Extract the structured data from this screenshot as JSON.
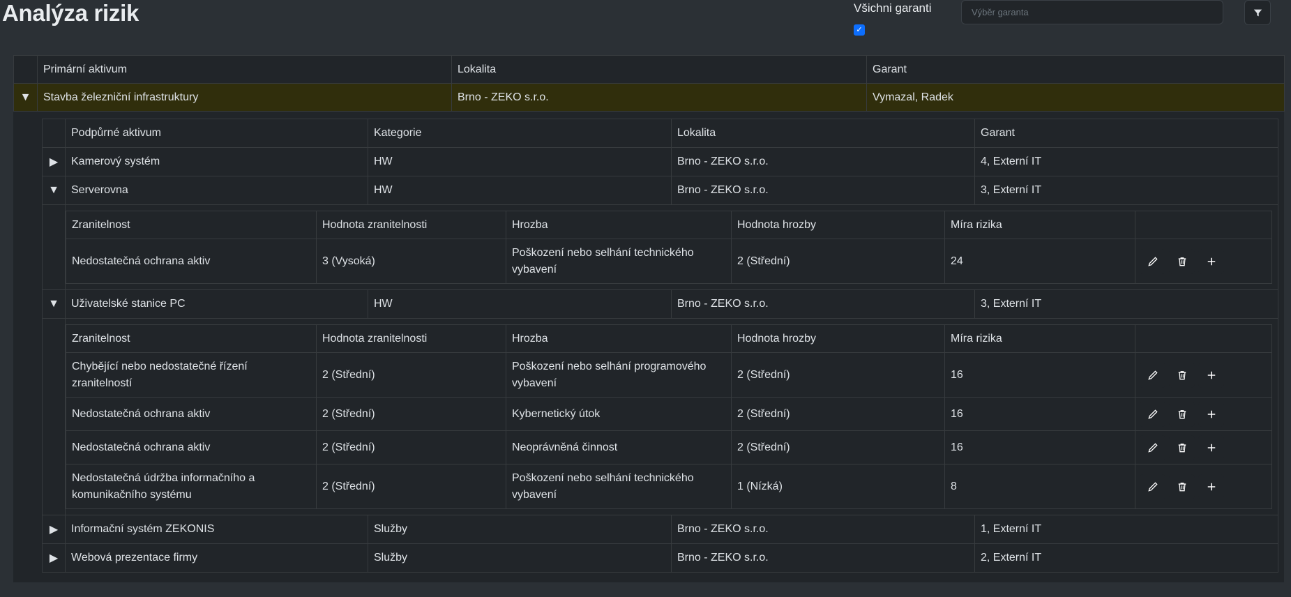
{
  "page": {
    "title": "Analýza rizik"
  },
  "filter": {
    "label": "Všichni garanti",
    "checked": true,
    "placeholder": "Výběr garanta",
    "filter_icon": "filter-icon"
  },
  "main_table": {
    "headers": [
      "Primární aktivum",
      "Lokalita",
      "Garant"
    ],
    "primary_row": {
      "asset": "Stavba železniční infrastruktury",
      "location": "Brno - ZEKO s.r.o.",
      "guarantor": "Vymazal, Radek"
    }
  },
  "support_table": {
    "headers": [
      "Podpůrné aktivum",
      "Kategorie",
      "Lokalita",
      "Garant"
    ],
    "rows": [
      {
        "asset": "Kamerový systém",
        "category": "HW",
        "location": "Brno - ZEKO s.r.o.",
        "guarantor": "4, Externí IT",
        "expanded": false
      },
      {
        "asset": "Serverovna",
        "category": "HW",
        "location": "Brno - ZEKO s.r.o.",
        "guarantor": "3, Externí IT",
        "expanded": true
      },
      {
        "asset": "Uživatelské stanice PC",
        "category": "HW",
        "location": "Brno - ZEKO s.r.o.",
        "guarantor": "3, Externí IT",
        "expanded": true
      },
      {
        "asset": "Informační systém ZEKONIS",
        "category": "Služby",
        "location": "Brno - ZEKO s.r.o.",
        "guarantor": "1, Externí IT",
        "expanded": false
      },
      {
        "asset": "Webová prezentace firmy",
        "category": "Služby",
        "location": "Brno - ZEKO s.r.o.",
        "guarantor": "2, Externí IT",
        "expanded": false
      }
    ]
  },
  "vuln_headers": [
    "Zranitelnost",
    "Hodnota zranitelnosti",
    "Hrozba",
    "Hodnota hrozby",
    "Míra rizika"
  ],
  "serverovna_vulns": [
    {
      "vulnerability": "Nedostatečná ochrana aktiv",
      "vuln_value": "3 (Vysoká)",
      "threat": "Poškození nebo selhání technického vybavení",
      "threat_value": "2 (Střední)",
      "risk": "24"
    }
  ],
  "pc_vulns": [
    {
      "vulnerability": "Chybějící nebo nedostatečné řízení zranitelností",
      "vuln_value": "2 (Střední)",
      "threat": "Poškození nebo selhání programového vybavení",
      "threat_value": "2 (Střední)",
      "risk": "16"
    },
    {
      "vulnerability": "Nedostatečná ochrana aktiv",
      "vuln_value": "2 (Střední)",
      "threat": "Kybernetický útok",
      "threat_value": "2 (Střední)",
      "risk": "16"
    },
    {
      "vulnerability": "Nedostatečná ochrana aktiv",
      "vuln_value": "2 (Střední)",
      "threat": "Neoprávněná činnost",
      "threat_value": "2 (Střední)",
      "risk": "16"
    },
    {
      "vulnerability": "Nedostatečná údržba informačního a komunikačního systému",
      "vuln_value": "2 (Střední)",
      "threat": "Poškození nebo selhání technického vybavení",
      "threat_value": "1 (Nízká)",
      "risk": "8"
    }
  ],
  "colors": {
    "teal": "#0b4446",
    "high": "#8c651b",
    "medium": "#8c8a22",
    "low": "#587e2b",
    "risk_high": "#3a2b0d",
    "risk_medium": "#2a3222",
    "primary_row": "#302e0c"
  },
  "icons": {
    "edit": "pencil-icon",
    "delete": "trash-icon",
    "add": "plus-icon",
    "expanded": "caret-down-icon",
    "collapsed": "caret-right-icon"
  }
}
